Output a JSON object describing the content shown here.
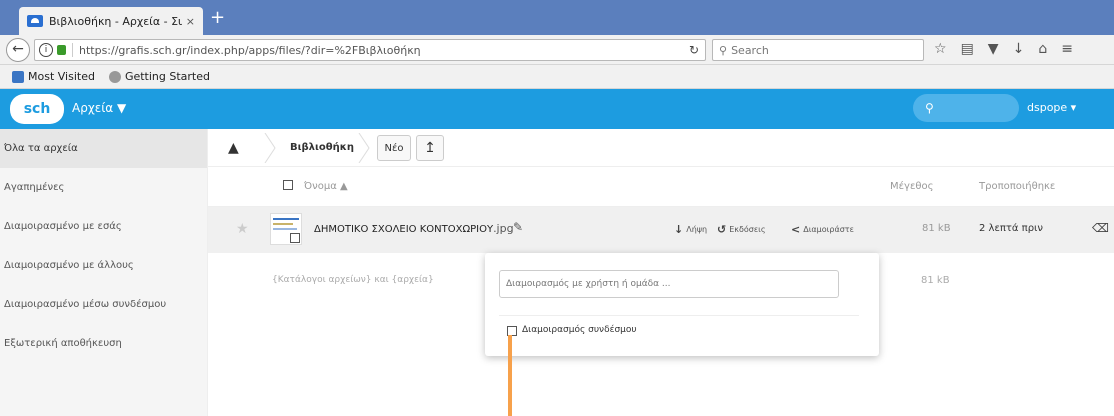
{
  "browser": {
    "tab_title": "Βιβλιοθήκη - Αρχεία - Συνεργ...",
    "tab_close": "×",
    "new_tab": "+",
    "url": "https://grafis.sch.gr/index.php/apps/files/?dir=%2FBιβλιοθήκη",
    "search_placeholder": "Search",
    "bookmarks": [
      "Most Visited",
      "Getting Started"
    ]
  },
  "app": {
    "logo": "sch",
    "name": "Αρχεία ▼",
    "user": "dspope ▾",
    "search_placeholder": ""
  },
  "sidebar": {
    "items": [
      "Όλα τα αρχεία",
      "Αγαπημένες",
      "Διαμοιρασμένο με εσάς",
      "Διαμοιρασμένο με άλλους",
      "Διαμοιρασμένο μέσω συνδέσμου",
      "Εξωτερική αποθήκευση"
    ]
  },
  "breadcrumb": {
    "current": "Βιβλιοθήκη",
    "new_button": "Νέο"
  },
  "table": {
    "col_name": "Όνομα ▲",
    "col_size": "Μέγεθος",
    "col_modified": "Τροποποιήθηκε"
  },
  "file": {
    "name": "ΔΗΜΟΤΙΚΟ ΣΧΟΛΕΙΟ ΚΟΝΤΟΧΩΡΙΟΥ",
    "ext": ".jpg",
    "download": "Λήψη",
    "versions": "Εκδόσεις",
    "share": "Διαμοιράστε",
    "size": "81 kB",
    "modified": "2 λεπτά πριν"
  },
  "empty_row": {
    "text": "{Κατάλογοι αρχείων} και {αρχεία}",
    "size": "81 kB"
  },
  "share_popup": {
    "input_placeholder": "Διαμοιρασμός με χρήστη ή ομάδα ...",
    "link_label": "Διαμοιρασμός συνδέσμου"
  }
}
